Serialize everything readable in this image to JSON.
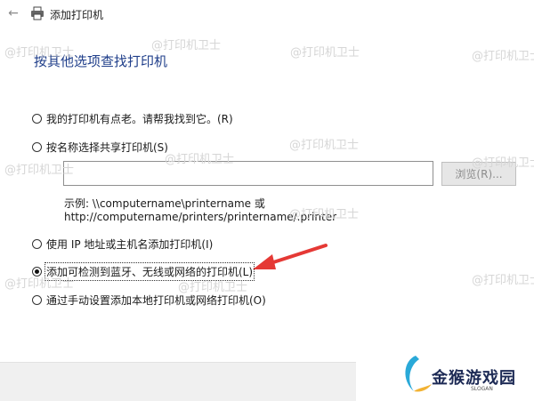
{
  "window": {
    "title": "添加打印机",
    "back_icon": "left-arrow-icon",
    "app_icon": "printer-icon"
  },
  "heading": "按其他选项查找打印机",
  "options": [
    {
      "label": "我的打印机有点老。请帮我找到它。(R)",
      "checked": false
    },
    {
      "label": "按名称选择共享打印机(S)",
      "checked": false
    },
    {
      "label": "使用 IP 地址或主机名添加打印机(I)",
      "checked": false
    },
    {
      "label": "添加可检测到蓝牙、无线或网络的打印机(L)",
      "checked": true
    },
    {
      "label": "通过手动设置添加本地打印机或网络打印机(O)",
      "checked": false
    }
  ],
  "share_input": {
    "value": "",
    "placeholder": ""
  },
  "browse_label": "浏览(R)...",
  "example_line1": "示例: \\\\computername\\printername 或",
  "example_line2": "http://computername/printers/printername/.printer",
  "watermark": "@打印机卫士",
  "logo": {
    "text": "金猴游戏园",
    "sub": "SLOGAN"
  },
  "colors": {
    "heading": "#1f3e8a",
    "arrow": "#e53935",
    "footer": "#f0f0f0"
  }
}
